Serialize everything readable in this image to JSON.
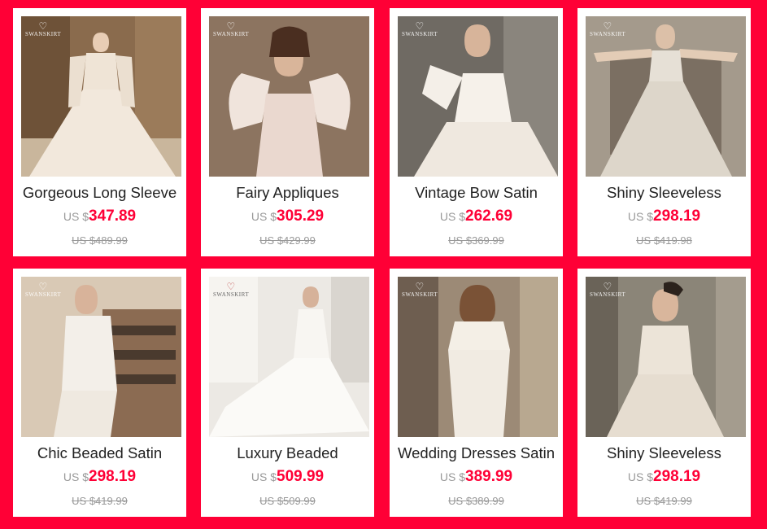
{
  "brand_logo": "SWANSKIRT",
  "currency_prefix": "US $",
  "colors": {
    "background": "#ff0036",
    "price": "#ff0036",
    "old_price": "#999999"
  },
  "products": [
    {
      "title": "Gorgeous Long Sleeve",
      "price": "347.89",
      "old_price": "US $489.99"
    },
    {
      "title": "Fairy Appliques",
      "price": "305.29",
      "old_price": "US $429.99"
    },
    {
      "title": "Vintage Bow Satin",
      "price": "262.69",
      "old_price": "US $369.99"
    },
    {
      "title": "Shiny Sleeveless",
      "price": "298.19",
      "old_price": "US $419.98"
    },
    {
      "title": "Chic Beaded Satin",
      "price": "298.19",
      "old_price": "US $419.99"
    },
    {
      "title": "Luxury Beaded",
      "price": "509.99",
      "old_price": "US $509.99"
    },
    {
      "title": "Wedding Dresses Satin",
      "price": "389.99",
      "old_price": "US $389.99"
    },
    {
      "title": "Shiny Sleeveless",
      "price": "298.19",
      "old_price": "US $419.99"
    }
  ]
}
